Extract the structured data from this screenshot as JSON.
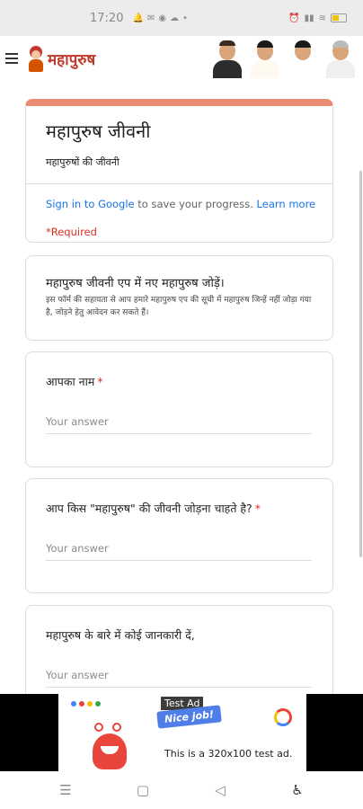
{
  "status_bar": {
    "time": "17:20",
    "notification_icons": [
      "bell-icon",
      "mail-icon",
      "app-icon",
      "cloud-icon"
    ],
    "dot": "•",
    "right_icons": [
      "alarm-icon",
      "signal-icon",
      "wifi-icon"
    ],
    "battery_level": 0.45
  },
  "header": {
    "logo_text": "महापुरुष",
    "portraits": [
      "portrait-1",
      "portrait-2",
      "portrait-3",
      "portrait-4"
    ]
  },
  "form": {
    "accent_color": "#ea8b73",
    "title": "महापुरुष जीवनी",
    "description": "महापुरुषों की जीवनी",
    "signin_link": "Sign in to Google",
    "signin_text": " to save your progress. ",
    "learn_more": "Learn more",
    "required_note": "*Required"
  },
  "info": {
    "title": "महापुरुष जीवनी एप में नए महापुरुष जोड़ें।",
    "text": "इस फॉर्म की सहायता से आप हमारे महापुरुष एप की सूची में महापुरुष जिन्हें नहीं जोड़ा गया है, जोड़ने हेतु आवेदन कर सकते हैं।"
  },
  "questions": [
    {
      "label": "आपका नाम",
      "required": "*",
      "placeholder": "Your answer"
    },
    {
      "label": "आप किस \"महापुरुष\" की जीवनी जोड़ना चाहते है?",
      "required": "*",
      "placeholder": "Your answer"
    },
    {
      "label": "महापुरुष के बारे में कोई जानकारी दें,",
      "placeholder": "Your answer"
    }
  ],
  "ad": {
    "tag": "Test Ad",
    "badge": "Nice job!",
    "copy": "This is a 320x100 test ad.",
    "dot_colors": [
      "#4285f4",
      "#ea4335",
      "#fbbc05",
      "#34a853"
    ]
  },
  "nav": {
    "recents": "☰",
    "home": "▢",
    "back": "◁",
    "accessibility": "♿"
  }
}
